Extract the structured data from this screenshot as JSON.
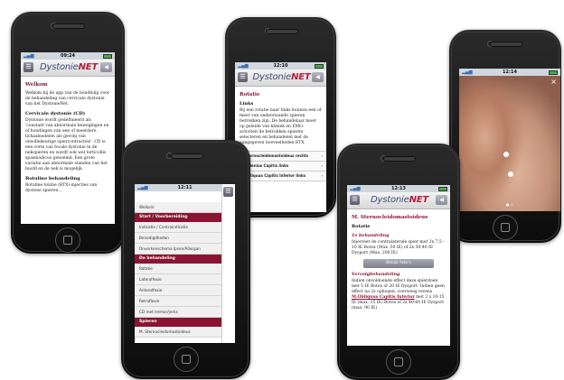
{
  "app": {
    "logo_main": "Dystonie",
    "logo_accent": "NET",
    "menu_icon": "menu-icon",
    "back_icon": "back-icon"
  },
  "phone1": {
    "time": "09:24",
    "title": "Welkom",
    "intro": "Welkom bij de app van de bondhulp voor de behandeling van cervicale dystonie van het DystonieNet.",
    "section1_title": "Cervicale dystonie (CD)",
    "section1_text": "Dystonie wordt gedefinieerd als 'constant van abnormale bewegingen en of houdingen van een of meerdere lichaamsdelen als gevolg van onwillekeurige spiercontracties'. CD is een vorm van focale dystonie in de nekspieren en wordt ook wel torticollis spasmodicus genoemd. Een grote variatie aan abnormale standen van het hoofd en de nek is mogelijk.",
    "section2_title": "Botuline behandeling",
    "section2_text": "Botuline toxine (BTX)-injecties van dystone spieren..."
  },
  "phone2": {
    "time": "12:10",
    "title": "Rotatie",
    "subtitle": "Links",
    "text": "Bij een rotatie naar links kunnen een of meer van onderstaande spieren betrokken zijn. De behandelaar moet op geleide van kliniek en EMG-activiteit de betrokken spieren selecteren en behandelen met de aangegeven hoeveelheden BTX.",
    "items": [
      "M. Sternocleidomastoideus rechts",
      "M. Splenius Capitis links",
      "M. Obliquus Capitis Inferior links"
    ],
    "chevron": "›"
  },
  "phone3": {
    "time": "12:14",
    "close": "×",
    "pager": "● ○"
  },
  "phone4": {
    "time": "12:11",
    "menu": [
      {
        "type": "it",
        "label": "Welkom"
      },
      {
        "type": "sec",
        "label": "Start / Voorbereiding"
      },
      {
        "type": "it",
        "label": "Indicatie / Contraindicatie"
      },
      {
        "type": "it",
        "label": "Benodigdheden"
      },
      {
        "type": "it",
        "label": "Onverkenschema Ipsen/Allergan"
      },
      {
        "type": "sec",
        "label": "De behandeling"
      },
      {
        "type": "it",
        "label": "Rotatie"
      },
      {
        "type": "it",
        "label": "Laterolfexie"
      },
      {
        "type": "it",
        "label": "Anterolfexie"
      },
      {
        "type": "it",
        "label": "Retroflexie"
      },
      {
        "type": "it",
        "label": "CD met tremor/jerks"
      },
      {
        "type": "sec",
        "label": "Spieren"
      },
      {
        "type": "it",
        "label": "M. Sternocleidomastoideus"
      }
    ]
  },
  "phone5": {
    "time": "12:13",
    "title": "M. Sternocleidomastoideus",
    "subtitle": "Rotatie",
    "h1": "1e behandeling",
    "text1": "Injecteer de contralaterale spier met 2x 7.5 - 10 IE Botox (Max. 50 IE) of 2x 30-40 IE Dysport (Max. 200 IE)",
    "button": "Bekijk foto's",
    "h2": "Vervolgbehandeling",
    "text2": "Indien onvoldoende effect deze spierdoen met 5 IE Botox of 20 IE Dysport. Indien geen effect na 2x ophogen, overweeg tevens",
    "link": "M.Obliquus Capitis Inferior",
    "text3": "met 2 x 10-15 IE (max. 15 IE) Botox of 2x 40-60 IE Dysport (max. 90 IE)"
  }
}
